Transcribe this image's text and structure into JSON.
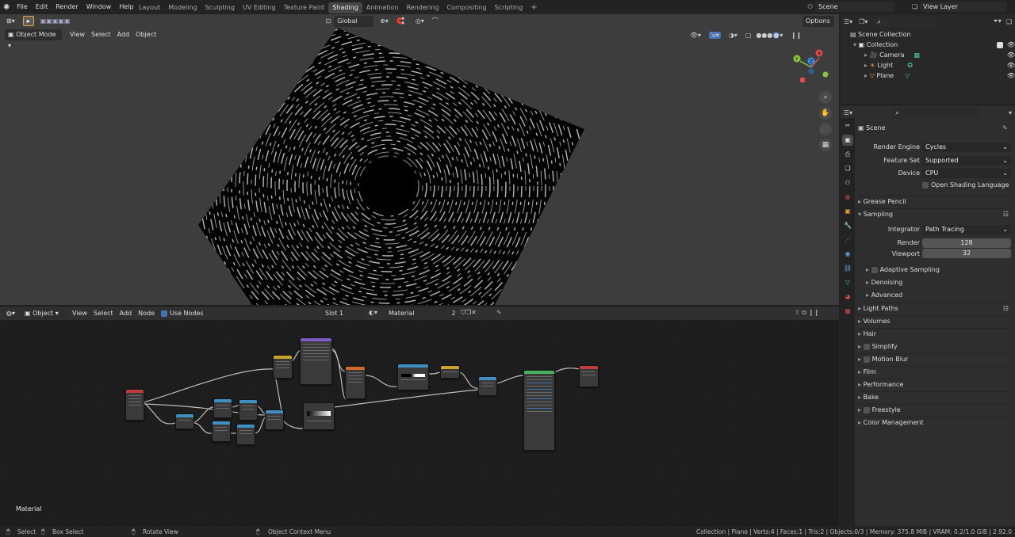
{
  "topbar": {
    "menus": [
      "File",
      "Edit",
      "Render",
      "Window",
      "Help"
    ],
    "workspaces": [
      "Layout",
      "Modeling",
      "Sculpting",
      "UV Editing",
      "Texture Paint",
      "Shading",
      "Animation",
      "Rendering",
      "Compositing",
      "Scripting"
    ],
    "active_workspace": "Shading",
    "scene_name": "Scene",
    "view_layer": "View Layer"
  },
  "tool_header": {
    "transform_orientation": "Global",
    "options_label": "Options"
  },
  "viewport": {
    "mode": "Object Mode",
    "menus": [
      "View",
      "Select",
      "Add",
      "Object"
    ]
  },
  "node_editor": {
    "type": "Object",
    "menus": [
      "View",
      "Select",
      "Add",
      "Node"
    ],
    "use_nodes_label": "Use Nodes",
    "slot": "Slot 1",
    "material_name": "Material",
    "user_count": "2",
    "overlay_label": "Material"
  },
  "outliner": {
    "root": "Scene Collection",
    "collection": "Collection",
    "items": [
      "Camera",
      "Light",
      "Plane"
    ]
  },
  "properties": {
    "context": "Scene",
    "render_engine_label": "Render Engine",
    "render_engine": "Cycles",
    "feature_set_label": "Feature Set",
    "feature_set": "Supported",
    "device_label": "Device",
    "device": "CPU",
    "osl_label": "Open Shading Language",
    "grease_pencil": "Grease Pencil",
    "sampling": "Sampling",
    "integrator_label": "Integrator",
    "integrator": "Path Tracing",
    "render_label": "Render",
    "render_samples": "128",
    "viewport_label": "Viewport",
    "viewport_samples": "32",
    "adaptive_sampling": "Adaptive Sampling",
    "denoising": "Denoising",
    "advanced": "Advanced",
    "sections": [
      "Light Paths",
      "Volumes",
      "Hair",
      "Simplify",
      "Motion Blur",
      "Film",
      "Performance",
      "Bake",
      "Freestyle",
      "Color Management"
    ]
  },
  "statusbar": {
    "select": "Select",
    "box_select": "Box Select",
    "rotate_view": "Rotate View",
    "context_menu": "Object Context Menu",
    "stats": "Collection | Plane | Verts:4 | Faces:1 | Tris:2 | Objects:0/3 | Memory: 375.8 MiB | VRAM: 0.2/1.0 GiB | 2.92.0"
  }
}
